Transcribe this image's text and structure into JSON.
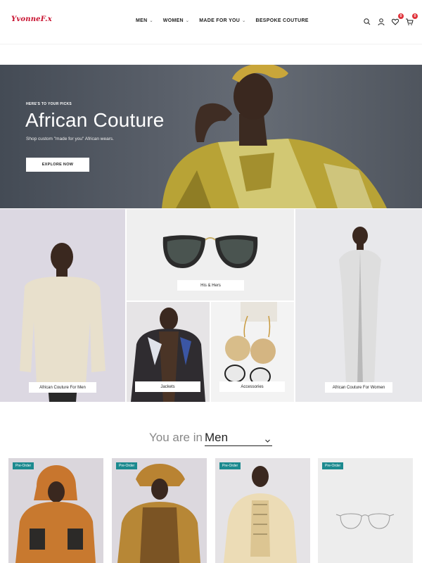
{
  "header": {
    "logo": "YvonneF.x",
    "nav": [
      {
        "label": "MEN",
        "has_dropdown": true
      },
      {
        "label": "WOMEN",
        "has_dropdown": true
      },
      {
        "label": "MADE FOR YOU",
        "has_dropdown": true
      },
      {
        "label": "BESPOKE COUTURE",
        "has_dropdown": false
      }
    ],
    "icons": [
      "search-icon",
      "user-icon",
      "heart-icon",
      "cart-icon"
    ],
    "wishlist_count": "0",
    "cart_count": "0"
  },
  "hero": {
    "eyebrow": "HERE'S TO YOUR PICKS",
    "title": "African Couture",
    "subtitle": "Shop custom \"made for you\" African wears.",
    "button": "EXPLORE NOW"
  },
  "categories": {
    "men": "African Couture For Men",
    "his_hers": "His & Hers",
    "jackets": "Jackets",
    "accessories": "Accessories",
    "women": "African Couture For Women"
  },
  "section": {
    "prefix": "You are in",
    "selected": "Men"
  },
  "products": [
    {
      "badge": "Pre-Order"
    },
    {
      "badge": "Pre-Order"
    },
    {
      "badge": "Pre-Order"
    },
    {
      "badge": "Pre-Order"
    }
  ],
  "colors": {
    "accent_red": "#c8102e",
    "badge_red": "#e0323a",
    "preorder_teal": "#1c8a8f"
  }
}
